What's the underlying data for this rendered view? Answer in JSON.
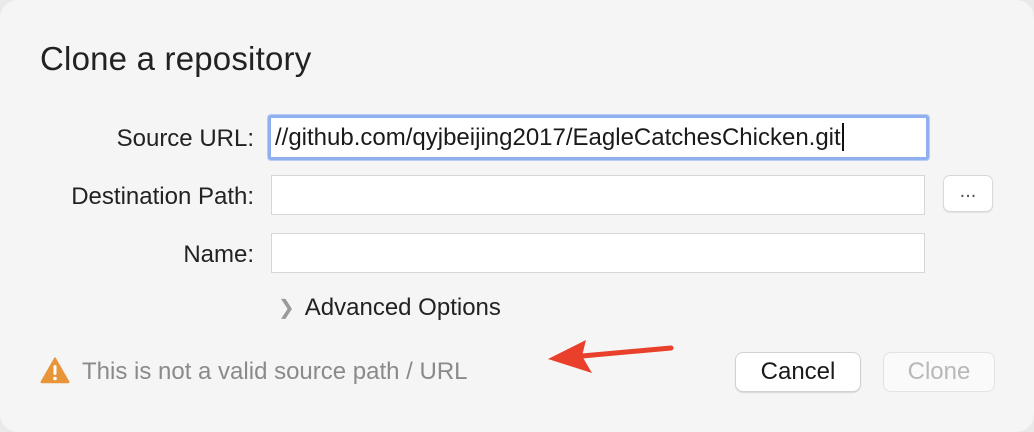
{
  "dialog": {
    "title": "Clone a repository"
  },
  "form": {
    "source_url_label": "Source URL:",
    "source_url_value": "//github.com/qyjbeijing2017/EagleCatchesChicken.git",
    "destination_path_label": "Destination Path:",
    "destination_path_value": "",
    "browse_label": "...",
    "name_label": "Name:",
    "name_value": "",
    "advanced_options_label": "Advanced Options"
  },
  "status": {
    "warning_text": "This is not a valid source path / URL",
    "warning_icon": "warning-triangle-icon",
    "warning_color": "#e8953a"
  },
  "annotation": {
    "arrow_color": "#e8402b"
  },
  "buttons": {
    "cancel_label": "Cancel",
    "clone_label": "Clone"
  }
}
